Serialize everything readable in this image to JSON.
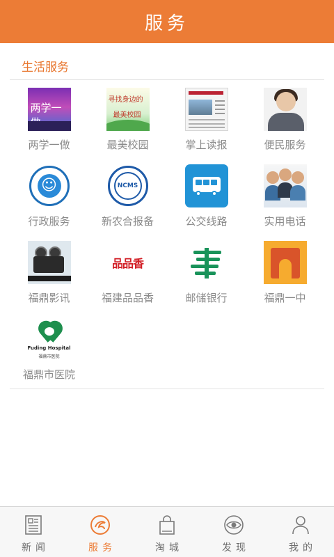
{
  "header": {
    "title": "服务"
  },
  "section": {
    "title": "生活服务"
  },
  "services": [
    {
      "label": "两学一做",
      "icon": "liangxue-yizuo-icon"
    },
    {
      "label": "最美校园",
      "icon": "campus-icon"
    },
    {
      "label": "掌上读报",
      "icon": "newspaper-icon"
    },
    {
      "label": "便民服务",
      "icon": "customer-service-icon"
    },
    {
      "label": "行政服务",
      "icon": "admin-service-icon"
    },
    {
      "label": "新农合报备",
      "icon": "ncms-icon"
    },
    {
      "label": "公交线路",
      "icon": "bus-icon"
    },
    {
      "label": "实用电话",
      "icon": "phone-operators-icon"
    },
    {
      "label": "福鼎影讯",
      "icon": "film-camera-icon"
    },
    {
      "label": "福建品品香",
      "icon": "pinpinxiang-logo-icon"
    },
    {
      "label": "邮储银行",
      "icon": "postal-bank-icon"
    },
    {
      "label": "福鼎一中",
      "icon": "school-gate-icon"
    },
    {
      "label": "福鼎市医院",
      "icon": "hospital-logo-icon"
    }
  ],
  "icon_text": {
    "liangxue": "两学一做",
    "campus_line1": "寻找身边的",
    "campus_line2": "最美校园",
    "smile": "☺",
    "ncms": "NCMS",
    "pinpinxiang": "品品香",
    "hospital_en": "Fuding Hospital",
    "hospital_cn": "福鼎市医院"
  },
  "tabs": [
    {
      "label": "新闻",
      "icon": "newspaper-tab-icon",
      "active": false
    },
    {
      "label": "服务",
      "icon": "service-tab-icon",
      "active": true
    },
    {
      "label": "淘城",
      "icon": "shopping-bag-icon",
      "active": false
    },
    {
      "label": "发现",
      "icon": "discover-eye-icon",
      "active": false
    },
    {
      "label": "我的",
      "icon": "profile-icon",
      "active": false
    }
  ],
  "colors": {
    "accent": "#ec7c36",
    "label": "#8a8a8a",
    "divider": "#e3e3e3"
  }
}
